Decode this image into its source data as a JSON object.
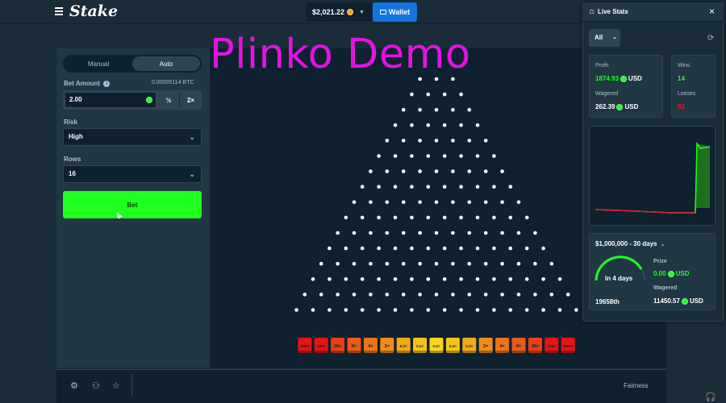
{
  "header": {
    "logo": "Stake",
    "balance": "$2,021.22",
    "wallet_label": "Wallet"
  },
  "overlay_title": "Plinko Demo",
  "controls": {
    "tabs": [
      {
        "label": "Manual",
        "active": false
      },
      {
        "label": "Auto",
        "active": true
      }
    ],
    "bet_amount_label": "Bet Amount",
    "bet_amount_btc": "0.00005114 BTC",
    "bet_amount_value": "2.00",
    "half_label": "½",
    "double_label": "2×",
    "risk_label": "Risk",
    "risk_value": "High",
    "rows_label": "Rows",
    "rows_value": "16",
    "bet_button_label": "Bet"
  },
  "board": {
    "rows": 16,
    "multipliers": [
      "1000×",
      "130×",
      "26×",
      "9×",
      "4×",
      "2×",
      "0.2×",
      "0.2×",
      "0.2×",
      "0.2×",
      "0.2×",
      "2×",
      "4×",
      "9×",
      "26×",
      "130×",
      "1000×"
    ],
    "bucket_colors": [
      "#e51415",
      "#e51415",
      "#e84117",
      "#ea5a18",
      "#ed7419",
      "#f08c1b",
      "#f3a91c",
      "#f5c21e",
      "#f8d51f",
      "#f5c21e",
      "#f3a91c",
      "#f08c1b",
      "#ed7419",
      "#ea5a18",
      "#e84117",
      "#e51415",
      "#e51415"
    ],
    "peg_color": "#ffffff"
  },
  "bottom_bar": {
    "fairness_label": "Fairness"
  },
  "live_stats": {
    "title": "Live Stats",
    "filter": "All",
    "profit_label": "Profit",
    "profit_value": "1874.93",
    "currency": "USD",
    "wagered_label": "Wagered",
    "wagered_value": "262.39",
    "wins_label": "Wins",
    "wins_value": "14",
    "losses_label": "Losses",
    "losses_value": "92",
    "race_title": "$1,000,000 - 30 days",
    "race_countdown": "In 4 days",
    "rank": "19658th",
    "prize_label": "Prize",
    "prize_value": "0.00",
    "race_wagered_label": "Wagered",
    "race_wagered_value": "11450.57"
  },
  "colors": {
    "accent_green": "#1fff20",
    "wallet_blue": "#1475e1",
    "loss_red": "#e9113c",
    "watermark_magenta": "#e313e3"
  }
}
